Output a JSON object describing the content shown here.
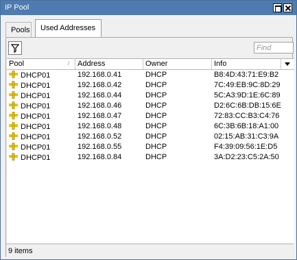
{
  "window": {
    "title": "IP Pool"
  },
  "tabs": [
    {
      "label": "Pools"
    },
    {
      "label": "Used Addresses"
    }
  ],
  "toolbar": {
    "filter_icon": "filter-icon",
    "find_placeholder": "Find"
  },
  "table": {
    "columns": [
      "Pool",
      "Address",
      "Owner",
      "Info"
    ],
    "rows": [
      {
        "pool": "DHCP01",
        "address": "192.168.0.41",
        "owner": "DHCP",
        "info": "B8:4D:43:71:E9:B2"
      },
      {
        "pool": "DHCP01",
        "address": "192.168.0.42",
        "owner": "DHCP",
        "info": "7C:49:EB:9C:8D:29"
      },
      {
        "pool": "DHCP01",
        "address": "192.168.0.44",
        "owner": "DHCP",
        "info": "5C:A3:9D:1E:6C:89"
      },
      {
        "pool": "DHCP01",
        "address": "192.168.0.46",
        "owner": "DHCP",
        "info": "D2:6C:6B:DB:15:6E"
      },
      {
        "pool": "DHCP01",
        "address": "192.168.0.47",
        "owner": "DHCP",
        "info": "72:83:CC:B3:C4:76"
      },
      {
        "pool": "DHCP01",
        "address": "192.168.0.48",
        "owner": "DHCP",
        "info": "6C:3B:6B:18:A1:00"
      },
      {
        "pool": "DHCP01",
        "address": "192.168.0.52",
        "owner": "DHCP",
        "info": "02:15:AB:31:C3:9A"
      },
      {
        "pool": "DHCP01",
        "address": "192.168.0.55",
        "owner": "DHCP",
        "info": "F4:39:09:56:1E:D5"
      },
      {
        "pool": "DHCP01",
        "address": "192.168.0.84",
        "owner": "DHCP",
        "info": "3A:D2:23:C5:2A:50"
      }
    ]
  },
  "status": {
    "count": "9 items"
  },
  "colors": {
    "titlebar": "#4e7bb0",
    "pool_icon": "#e8c400"
  }
}
